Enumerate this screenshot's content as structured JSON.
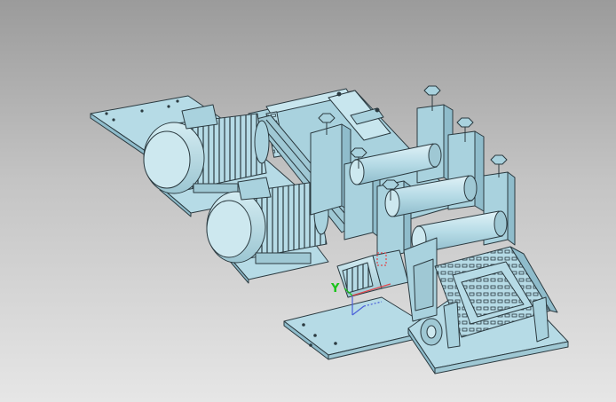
{
  "viewport": {
    "background_top": "#9b9b9b",
    "background_bottom": "#e6e6e6"
  },
  "model": {
    "part_color": "#b6dbe6",
    "edge_color": "#2b3a40",
    "shadow_color": "#7fa6b2"
  },
  "triad": {
    "y_label": "Y",
    "y_color": "#19c319",
    "x_color": "#e0474c",
    "z_color": "#4a5fd9"
  }
}
